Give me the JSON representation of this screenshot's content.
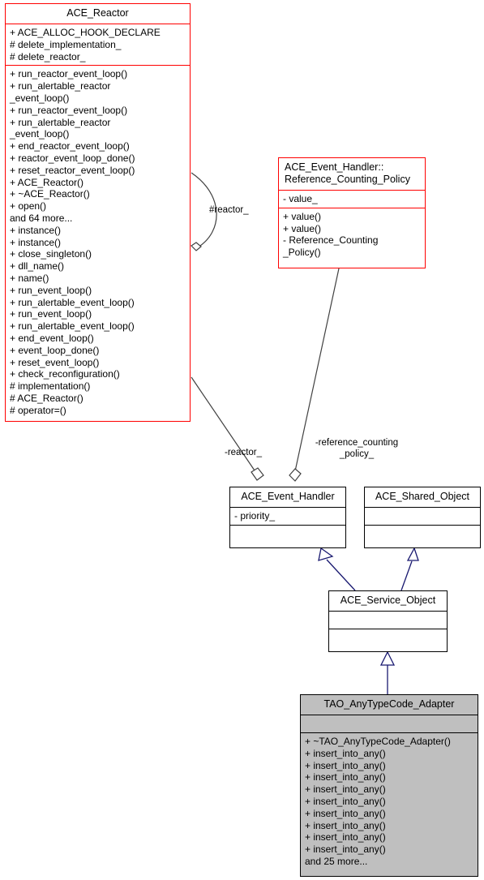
{
  "diagram": {
    "type": "uml-class-collaboration-diagram",
    "title": "TAO_AnyTypeCode_Adapter collaboration diagram",
    "colors": {
      "highlight_border": "#ff0000",
      "normal_border": "#000000",
      "focus_fill": "#bfbfbf",
      "normal_fill": "#ffffff",
      "inheritance_arrow": "#191970",
      "association_line": "#404040"
    }
  },
  "classes": {
    "ace_reactor": {
      "name": "ACE_Reactor",
      "attributes": [
        "+ ACE_ALLOC_HOOK_DECLARE",
        "# delete_implementation_",
        "# delete_reactor_"
      ],
      "operations": [
        "+ run_reactor_event_loop()",
        "+ run_alertable_reactor",
        "_event_loop()",
        "+ run_reactor_event_loop()",
        "+ run_alertable_reactor",
        "_event_loop()",
        "+ end_reactor_event_loop()",
        "+ reactor_event_loop_done()",
        "+ reset_reactor_event_loop()",
        "+ ACE_Reactor()",
        "+ ~ACE_Reactor()",
        "+ open()",
        "and 64 more...",
        "+ instance()",
        "+ instance()",
        "+ close_singleton()",
        "+ dll_name()",
        "+ name()",
        "+ run_event_loop()",
        "+ run_alertable_event_loop()",
        "+ run_event_loop()",
        "+ run_alertable_event_loop()",
        "+ end_event_loop()",
        "+ event_loop_done()",
        "+ reset_event_loop()",
        "+ check_reconfiguration()",
        "# implementation()",
        "# ACE_Reactor()",
        "# operator=()"
      ]
    },
    "reference_counting_policy": {
      "name": "ACE_Event_Handler::\nReference_Counting_Policy",
      "attributes": [
        "- value_"
      ],
      "operations": [
        "+ value()",
        "+ value()",
        "- Reference_Counting",
        "_Policy()"
      ]
    },
    "ace_event_handler": {
      "name": "ACE_Event_Handler",
      "attributes": [
        "- priority_"
      ],
      "operations": []
    },
    "ace_shared_object": {
      "name": "ACE_Shared_Object",
      "attributes": [],
      "operations": []
    },
    "ace_service_object": {
      "name": "ACE_Service_Object",
      "attributes": [],
      "operations": []
    },
    "tao_anytypecode_adapter": {
      "name": "TAO_AnyTypeCode_Adapter",
      "attributes": [],
      "operations": [
        "+ ~TAO_AnyTypeCode_Adapter()",
        "+ insert_into_any()",
        "+ insert_into_any()",
        "+ insert_into_any()",
        "+ insert_into_any()",
        "+ insert_into_any()",
        "+ insert_into_any()",
        "+ insert_into_any()",
        "+ insert_into_any()",
        "+ insert_into_any()",
        "and 25 more..."
      ]
    }
  },
  "edges": {
    "reactor_self_label": "#reactor_",
    "reactor_label": "-reactor_",
    "reference_counting_policy_label": "-reference_counting\n_policy_"
  }
}
